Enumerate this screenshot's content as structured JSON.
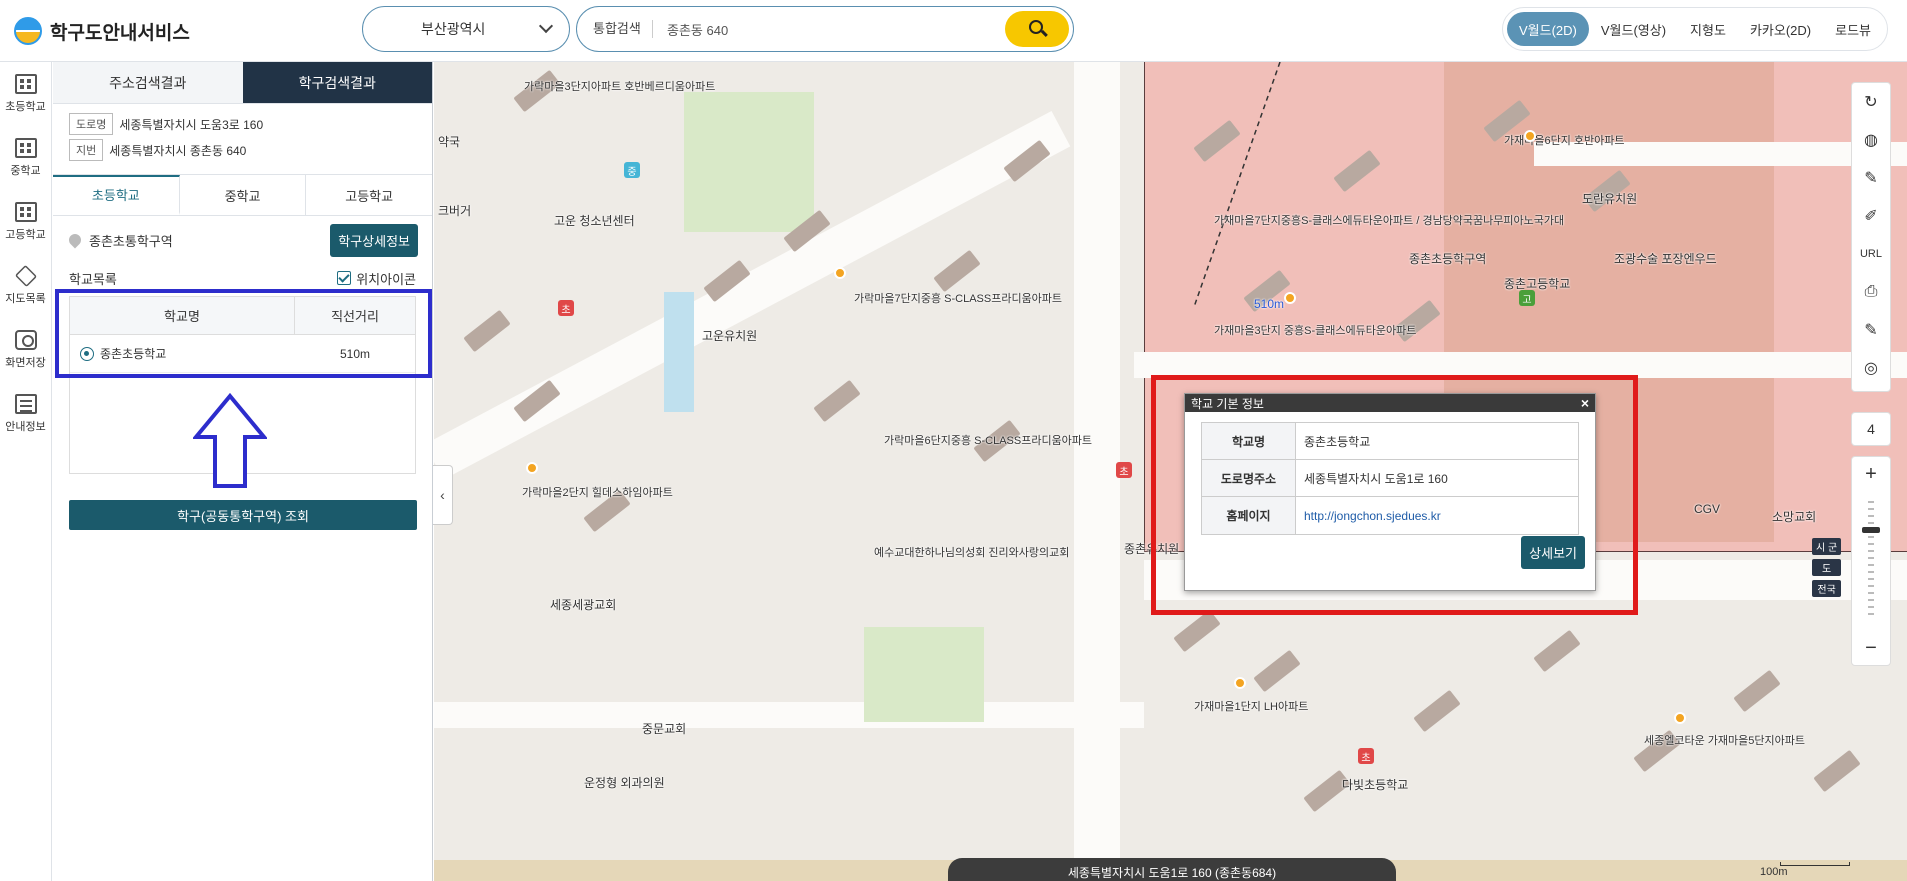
{
  "header": {
    "app_title": "학구도안내서비스",
    "region": "부산광역시",
    "search_type": "통합검색",
    "search_value": "종촌동 640",
    "map_tabs": [
      "V월드(2D)",
      "V월드(영상)",
      "지형도",
      "카카오(2D)",
      "로드뷰"
    ]
  },
  "leftnav": {
    "items": [
      "초등학교",
      "중학교",
      "고등학교",
      "지도목록",
      "화면저장",
      "안내정보"
    ]
  },
  "panel": {
    "tabs": [
      "주소검색결과",
      "학구검색결과"
    ],
    "road_tag": "도로명",
    "road_addr": "세종특별자치시 도움3로 160",
    "jibun_tag": "지번",
    "jibun_addr": "세종특별자치시 종촌동 640",
    "school_tabs": [
      "초등학교",
      "중학교",
      "고등학교"
    ],
    "zone_name": "종촌초통학구역",
    "detail_btn": "학구상세정보",
    "list_label": "학교목록",
    "location_icon_label": "위치아이콘",
    "table_headers": [
      "학교명",
      "직선거리"
    ],
    "rows": [
      {
        "name": "종촌초등학교",
        "distance": "510m"
      }
    ],
    "query_btn": "학구(공동통학구역) 조회"
  },
  "popup": {
    "title": "학교 기본 정보",
    "close": "×",
    "labels": [
      "학교명",
      "도로명주소",
      "홈페이지"
    ],
    "school_name": "종촌초등학교",
    "road_address": "세종특별자치시 도움1로 160",
    "homepage": "http://jongchon.sjedues.kr",
    "more_btn": "상세보기"
  },
  "map": {
    "labels": {
      "zone": "종촌초등학구역",
      "dist": "510m",
      "gaja3": "가재마을3단지 중흥S-클래스에듀타운아파트",
      "gaja7": "가재마을7단지중흥S-클래스에듀타운아파트 / 경남당약국꿈나무피아노국가대",
      "garak7": "가락마을7단지중흥 S-CLASS프라디움아파트",
      "garak6": "가락마을6단지중흥 S-CLASS프라디움아파트",
      "garak3": "가락마을3단지아파트 호반베르디움아파트",
      "garak2": "가락마을2단지 힐데스하임아파트",
      "gaja6": "가재마을6단지 호반아파트",
      "gaja1": "가재마을1단지 LH아파트",
      "goun_center": "고운 청소년센터",
      "goun_kinder": "고운유치원",
      "doran": "도란유치원",
      "jongchon_kinder": "종촌유치원",
      "jongchon_high": "종촌고등학교",
      "josun": "조광수술 포장엔우드",
      "church": "예수교대한하나님의성회 진리와사랑의교회",
      "sejong_church": "세종세광교회",
      "jungmun": "중문교회",
      "clinic": "운정형 외과의원",
      "dabit": "다빛초등학교",
      "cgv": "CGV",
      "somang": "소망교회",
      "sejong_elcota": "세종엘코타운 가재마을5단지아파트",
      "pharmacy": "약국",
      "burger": "크버거"
    },
    "zoom_level": "4",
    "scale_tags": [
      "시 군",
      "도",
      "전국"
    ],
    "status": "세종특별자치시 도움1로 160 (종촌동684)",
    "scale_text": "100m"
  },
  "tools": [
    "↻",
    "◍",
    "✎",
    "✐",
    "URL",
    "⎙",
    "✎",
    "◎"
  ]
}
